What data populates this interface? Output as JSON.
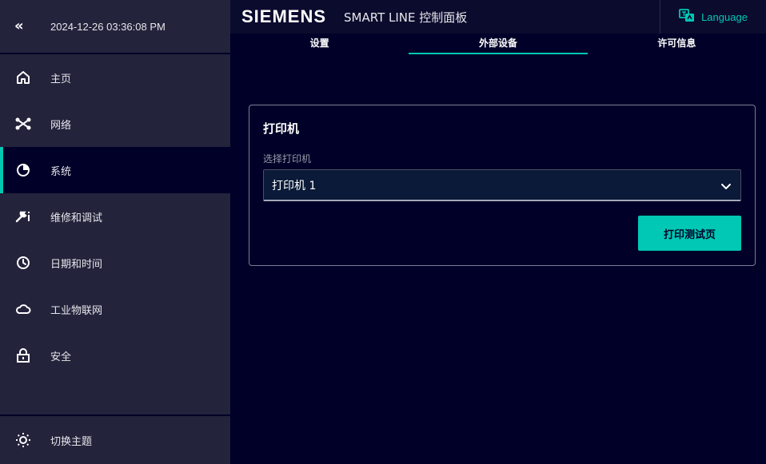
{
  "sidebar": {
    "collapse_icon": "double-chevron-left",
    "datetime": "2024-12-26 03:36:08 PM",
    "items": [
      {
        "label": "主页",
        "icon": "home-icon",
        "active": false
      },
      {
        "label": "网络",
        "icon": "network-icon",
        "active": false
      },
      {
        "label": "系统",
        "icon": "pie-chart-icon",
        "active": true
      },
      {
        "label": "维修和调试",
        "icon": "wrench-icon",
        "active": false
      },
      {
        "label": "日期和时间",
        "icon": "clock-icon",
        "active": false
      },
      {
        "label": "工业物联网",
        "icon": "cloud-icon",
        "active": false
      },
      {
        "label": "安全",
        "icon": "lock-icon",
        "active": false
      }
    ],
    "theme_toggle": {
      "label": "切换主题",
      "icon": "sun-icon"
    }
  },
  "header": {
    "brand": "SIEMENS",
    "title": "SMART LINE 控制面板",
    "language": {
      "label": "Language",
      "icon": "language-icon"
    }
  },
  "tabs": [
    {
      "label": "设置",
      "active": false
    },
    {
      "label": "外部设备",
      "active": true
    },
    {
      "label": "许可信息",
      "active": false
    }
  ],
  "printer_card": {
    "title": "打印机",
    "select_label": "选择打印机",
    "selected_value": "打印机 1",
    "print_button": "打印测试页"
  },
  "colors": {
    "background": "#000028",
    "sidebar": "#23233c",
    "accent": "#00c8b4"
  }
}
